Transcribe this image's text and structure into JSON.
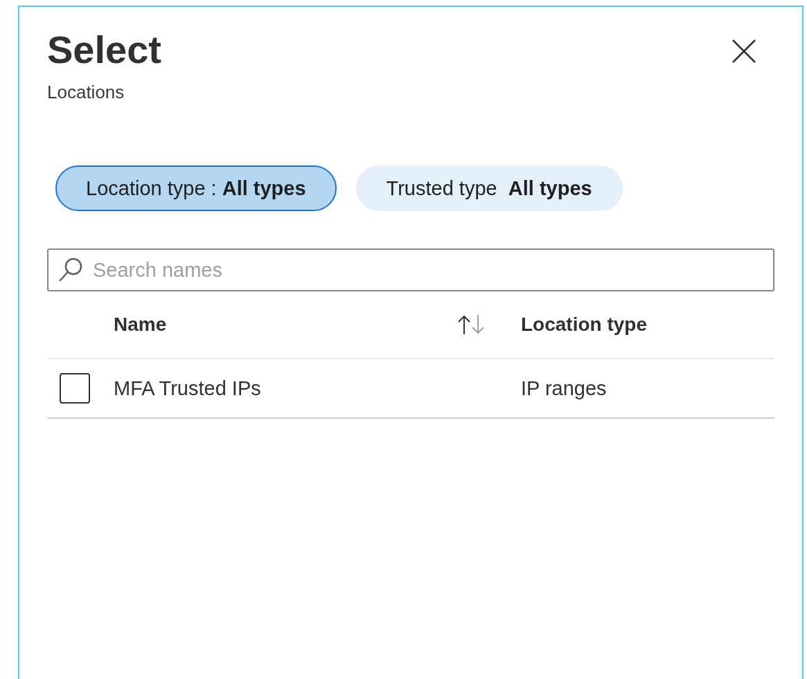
{
  "panel": {
    "title": "Select",
    "subtitle": "Locations"
  },
  "filters": [
    {
      "label": "Location type :",
      "value": "All types",
      "selected": true
    },
    {
      "label": "Trusted type",
      "value": "All types",
      "selected": false
    }
  ],
  "search": {
    "placeholder": "Search names"
  },
  "table": {
    "columns": [
      "Name",
      "Location type"
    ],
    "rows": [
      {
        "checked": false,
        "cells": [
          "MFA Trusted IPs",
          "IP ranges"
        ]
      }
    ]
  }
}
